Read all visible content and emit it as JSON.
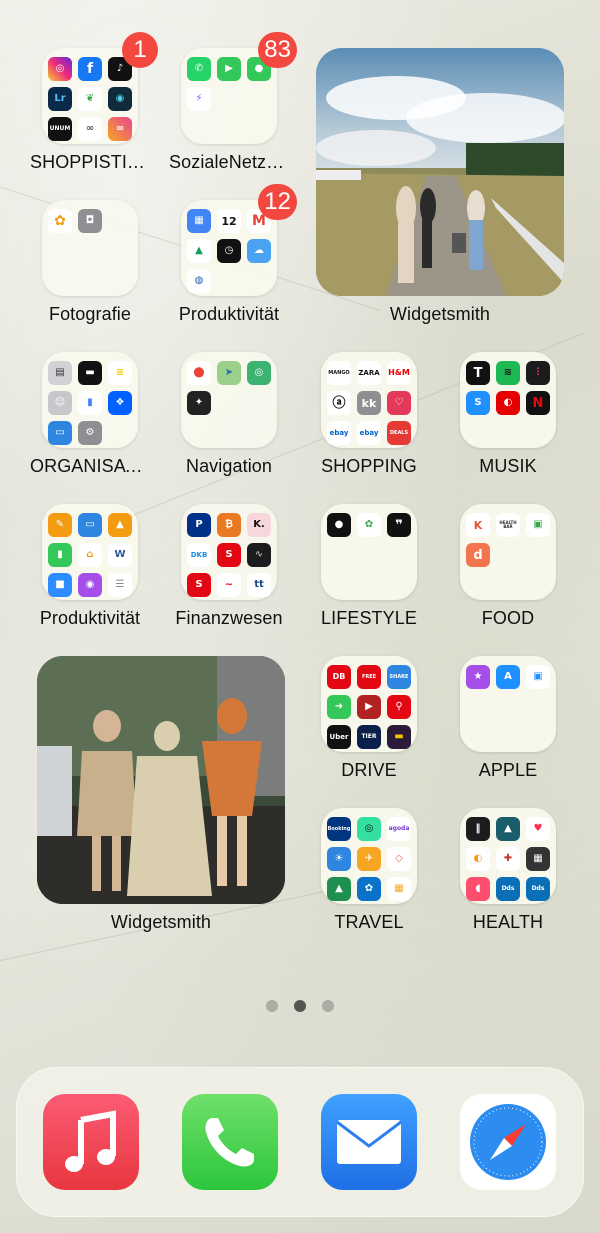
{
  "home": {
    "page_count": 3,
    "current_page": 2,
    "folders": [
      {
        "label": "SHOPPISTICA...",
        "badge": "1"
      },
      {
        "label": "SozialeNetzwe...",
        "badge": "83"
      },
      {
        "label": "Fotografie"
      },
      {
        "label": "Produktivität",
        "badge": "12"
      },
      {
        "label": "ORGANISATION"
      },
      {
        "label": "Navigation"
      },
      {
        "label": "SHOPPING"
      },
      {
        "label": "MUSIK"
      },
      {
        "label": "Produktivität"
      },
      {
        "label": "Finanzwesen"
      },
      {
        "label": "LIFESTYLE"
      },
      {
        "label": "FOOD"
      },
      {
        "label": "DRIVE"
      },
      {
        "label": "APPLE"
      },
      {
        "label": "TRAVEL"
      },
      {
        "label": "HEALTH"
      }
    ],
    "widgets": [
      {
        "label": "Widgetsmith"
      },
      {
        "label": "Widgetsmith"
      }
    ],
    "mini_labels": {
      "lr": "Lr",
      "unum": "UNUM",
      "cal_date": "12",
      "mango": "MANGO",
      "zara": "ZARA",
      "hm": "H&M",
      "kk": "kk",
      "ebay": "ebay",
      "deals": "DEALS",
      "t": "T",
      "k": "K.",
      "dkb": "DKB",
      "tt": "tt",
      "healthbar": "HEALTH BAR",
      "d": "d",
      "db": "DB",
      "free": "FREE",
      "share": "SHARE",
      "uber": "Uber",
      "tier": "TIER",
      "booking": "Booking",
      "agoda": "agoda",
      "dds": "Dds"
    }
  },
  "dock": [
    "music-app",
    "phone-app",
    "mail-app",
    "safari-app"
  ]
}
